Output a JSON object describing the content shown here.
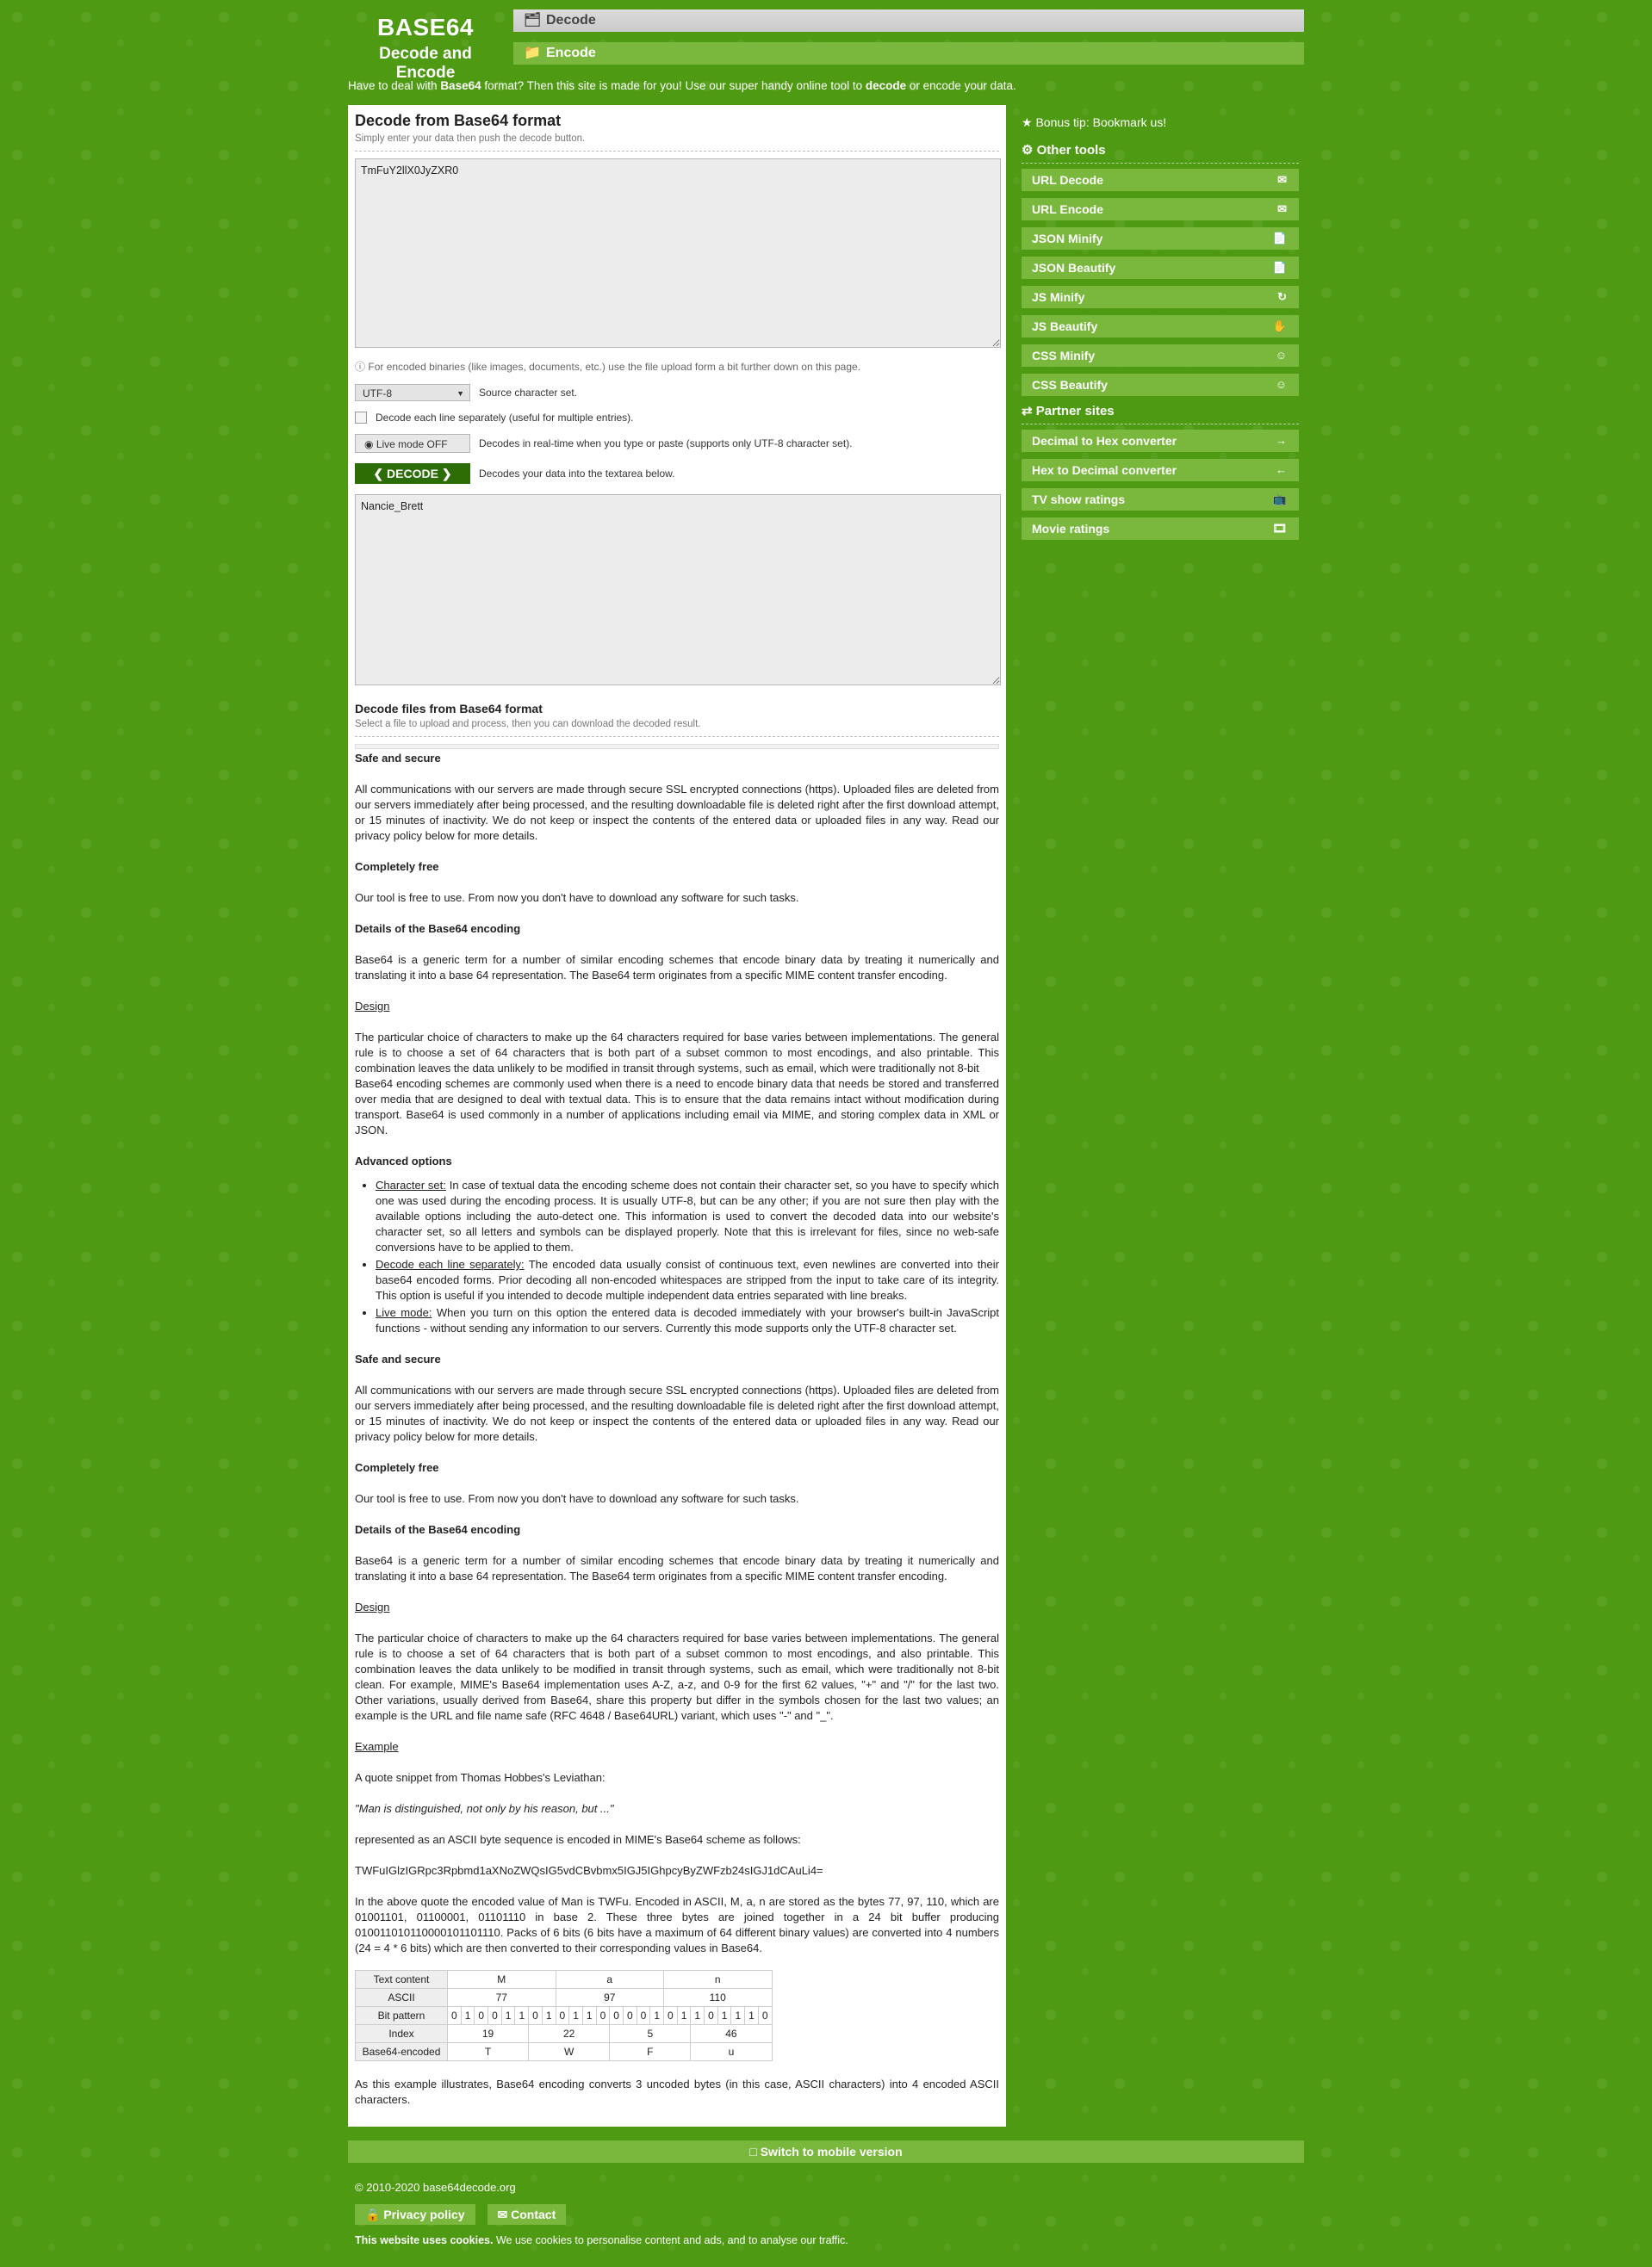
{
  "header": {
    "logo_title": "BASE64",
    "logo_subtitle": "Decode and Encode",
    "nav_decode": "Decode",
    "nav_encode": "Encode",
    "intro_before": "Have to deal with ",
    "intro_bold1": "Base64",
    "intro_mid": " format? Then this site is made for you! Use our super handy online tool to ",
    "intro_bold2": "decode",
    "intro_after": " or encode your data."
  },
  "decode": {
    "title": "Decode from Base64 format",
    "subtitle": "Simply enter your data then push the decode button.",
    "input_value": "TmFuY2llX0JyZXR0",
    "binary_hint": "For encoded binaries (like images, documents, etc.) use the file upload form a bit further down on this page.",
    "charset_value": "UTF-8",
    "charset_label": "Source character set.",
    "each_line_label": "Decode each line separately (useful for multiple entries).",
    "live_mode_button": "Live mode OFF",
    "live_mode_desc": "Decodes in real-time when you type or paste (supports only UTF-8 character set).",
    "decode_button": "DECODE",
    "decode_desc": "Decodes your data into the textarea below.",
    "output_value": "Nancie_Brett"
  },
  "files": {
    "title": "Decode files from Base64 format",
    "subtitle": "Select a file to upload and process, then you can download the decoded result."
  },
  "content": {
    "safe_h": "Safe and secure",
    "safe_p": "All communications with our servers are made through secure SSL encrypted connections (https). Uploaded files are deleted from our servers immediately after being processed, and the resulting downloadable file is deleted right after the first download attempt, or 15 minutes of inactivity. We do not keep or inspect the contents of the entered data or uploaded files in any way. Read our privacy policy below for more details.",
    "free_h": "Completely free",
    "free_p": "Our tool is free to use. From now you don't have to download any software for such tasks.",
    "details_h": "Details of the Base64 encoding",
    "details_p": "Base64 is a generic term for a number of similar encoding schemes that encode binary data by treating it numerically and translating it into a base 64 representation. The Base64 term originates from a specific MIME content transfer encoding.",
    "design_h": "Design",
    "design_p1": "The particular choice of characters to make up the 64 characters required for base varies between implementations. The general rule is to choose a set of 64 characters that is both part of a subset common to most encodings, and also printable. This combination leaves the data unlikely to be modified in transit through systems, such as email, which were traditionally not 8-bit",
    "design_p1b": "Base64 encoding schemes are commonly used when there is a need to encode binary data that needs be stored and transferred over media that are designed to deal with textual data. This is to ensure that the data remains intact without modification during transport. Base64 is used commonly in a number of applications including email via MIME, and storing complex data in XML or JSON.",
    "adv_h": "Advanced options",
    "adv_items": [
      {
        "t": "Character set:",
        "d": " In case of textual data the encoding scheme does not contain their character set, so you have to specify which one was used during the encoding process. It is usually UTF-8, but can be any other; if you are not sure then play with the available options including the auto-detect one. This information is used to convert the decoded data into our website's character set, so all letters and symbols can be displayed properly. Note that this is irrelevant for files, since no web-safe conversions have to be applied to them."
      },
      {
        "t": "Decode each line separately:",
        "d": " The encoded data usually consist of continuous text, even newlines are converted into their base64 encoded forms. Prior decoding all non-encoded whitespaces are stripped from the input to take care of its integrity. This option is useful if you intended to decode multiple independent data entries separated with line breaks."
      },
      {
        "t": "Live mode:",
        "d": " When you turn on this option the entered data is decoded immediately with your browser's built-in JavaScript functions - without sending any information to our servers. Currently this mode supports only the UTF-8 character set."
      }
    ],
    "design_p2": "The particular choice of characters to make up the 64 characters required for base varies between implementations. The general rule is to choose a set of 64 characters that is both part of a subset common to most encodings, and also printable. This combination leaves the data unlikely to be modified in transit through systems, such as email, which were traditionally not 8-bit clean. For example, MIME's Base64 implementation uses A-Z, a-z, and 0-9 for the first 62 values, \"+\" and \"/\" for the last two. Other variations, usually derived from Base64, share this property but differ in the symbols chosen for the last two values; an example is the URL and file name safe (RFC 4648 / Base64URL) variant, which uses \"-\" and \"_\".",
    "example_h": "Example",
    "example_intro": "A quote snippet from Thomas Hobbes's Leviathan:",
    "quote": "\"Man is distinguished, not only by his reason, but ...\"",
    "repr": "represented as an ASCII byte sequence is encoded in MIME's Base64 scheme as follows:",
    "encoded": "TWFuIGlzIGRpc3Rpbmd1aXNoZWQsIG5vdCBvbmx5IGJ5IGhpcyByZWFzb24sIGJ1dCAuLi4=",
    "explain": "In the above quote the encoded value of Man is TWFu. Encoded in ASCII, M, a, n are stored as the bytes 77, 97, 110, which are 01001101, 01100001, 01101110 in base 2. These three bytes are joined together in a 24 bit buffer producing 010011010110000101101110. Packs of 6 bits (6 bits have a maximum of 64 different binary values) are converted into 4 numbers (24 = 4 * 6 bits) which are then converted to their corresponding values in Base64.",
    "final": "As this example illustrates, Base64 encoding converts 3 uncoded bytes (in this case, ASCII characters) into 4 encoded ASCII characters."
  },
  "table": {
    "row_labels": [
      "Text content",
      "ASCII",
      "Bit pattern",
      "Index",
      "Base64-encoded"
    ],
    "text": [
      "M",
      "a",
      "n"
    ],
    "ascii": [
      "77",
      "97",
      "110"
    ],
    "bits": [
      "0",
      "1",
      "0",
      "0",
      "1",
      "1",
      "0",
      "1",
      "0",
      "1",
      "1",
      "0",
      "0",
      "0",
      "0",
      "1",
      "0",
      "1",
      "1",
      "0",
      "1",
      "1",
      "1",
      "0"
    ],
    "index": [
      "19",
      "22",
      "5",
      "46"
    ],
    "encoded": [
      "T",
      "W",
      "F",
      "u"
    ]
  },
  "sidebar": {
    "tip": "Bonus tip: Bookmark us!",
    "other_tools_h": "Other tools",
    "tools": [
      "URL Decode",
      "URL Encode",
      "JSON Minify",
      "JSON Beautify",
      "JS Minify",
      "JS Beautify",
      "CSS Minify",
      "CSS Beautify"
    ],
    "partner_h": "Partner sites",
    "partners": [
      "Decimal to Hex converter",
      "Hex to Decimal converter",
      "TV show ratings",
      "Movie ratings"
    ]
  },
  "footer": {
    "mobile": "Switch to mobile version",
    "copyright": "2010-2020 base64decode.org",
    "privacy": "Privacy policy",
    "contact": "Contact",
    "cookie_bold": "This website uses cookies.",
    "cookie_text": " We use cookies to personalise content and ads, and to analyse our traffic."
  },
  "colors": {
    "bg": "#4e9a12",
    "button": "#79b83c",
    "decode_btn": "#2c6d06"
  }
}
